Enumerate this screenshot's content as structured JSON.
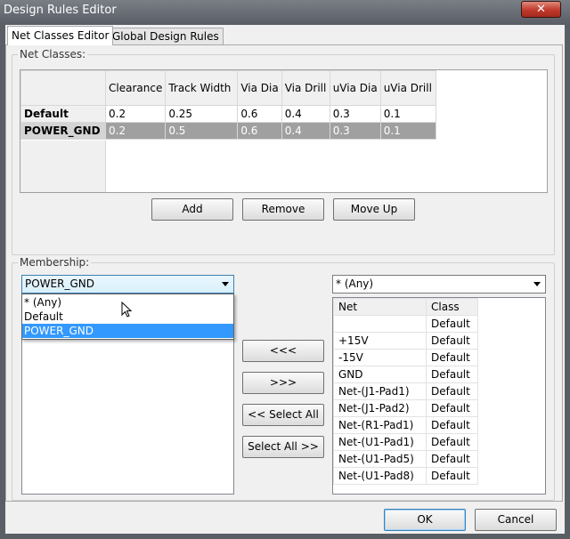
{
  "window": {
    "title": "Design Rules Editor",
    "close_label": "✕"
  },
  "tabs": [
    {
      "label": "Net Classes Editor",
      "active": true
    },
    {
      "label": "Global Design Rules",
      "active": false
    }
  ],
  "net_classes": {
    "group_label": "Net Classes:",
    "columns": [
      "Clearance",
      "Track Width",
      "Via Dia",
      "Via Drill",
      "uVia Dia",
      "uVia Drill"
    ],
    "rows": [
      {
        "name": "Default",
        "values": [
          "0.2",
          "0.25",
          "0.6",
          "0.4",
          "0.3",
          "0.1"
        ],
        "selected": false
      },
      {
        "name": "POWER_GND",
        "values": [
          "0.2",
          "0.5",
          "0.6",
          "0.4",
          "0.3",
          "0.1"
        ],
        "selected": true
      }
    ],
    "buttons": {
      "add": "Add",
      "remove": "Remove",
      "move_up": "Move Up"
    }
  },
  "membership": {
    "group_label": "Membership:",
    "left_combo_value": "POWER_GND",
    "left_combo_options": [
      "* (Any)",
      "Default",
      "POWER_GND"
    ],
    "highlighted_option": "POWER_GND",
    "right_combo_value": "* (Any)",
    "transfer_buttons": {
      "move_left": "<<<",
      "move_right": ">>>",
      "select_all_left": "<< Select All",
      "select_all_right": "Select All >>"
    },
    "net_table": {
      "headers": [
        "Net",
        "Class"
      ],
      "rows": [
        {
          "net": "",
          "class": "Default"
        },
        {
          "net": "+15V",
          "class": "Default"
        },
        {
          "net": "-15V",
          "class": "Default"
        },
        {
          "net": "GND",
          "class": "Default"
        },
        {
          "net": "Net-(J1-Pad1)",
          "class": "Default"
        },
        {
          "net": "Net-(J1-Pad2)",
          "class": "Default"
        },
        {
          "net": "Net-(R1-Pad1)",
          "class": "Default"
        },
        {
          "net": "Net-(U1-Pad1)",
          "class": "Default"
        },
        {
          "net": "Net-(U1-Pad5)",
          "class": "Default"
        },
        {
          "net": "Net-(U1-Pad8)",
          "class": "Default"
        }
      ]
    }
  },
  "footer": {
    "ok": "OK",
    "cancel": "Cancel"
  },
  "colors": {
    "accent": "#3399ff",
    "selected_row": "#a0a0a0",
    "title_bar": "#5b6068",
    "close_button": "#c0392b"
  }
}
